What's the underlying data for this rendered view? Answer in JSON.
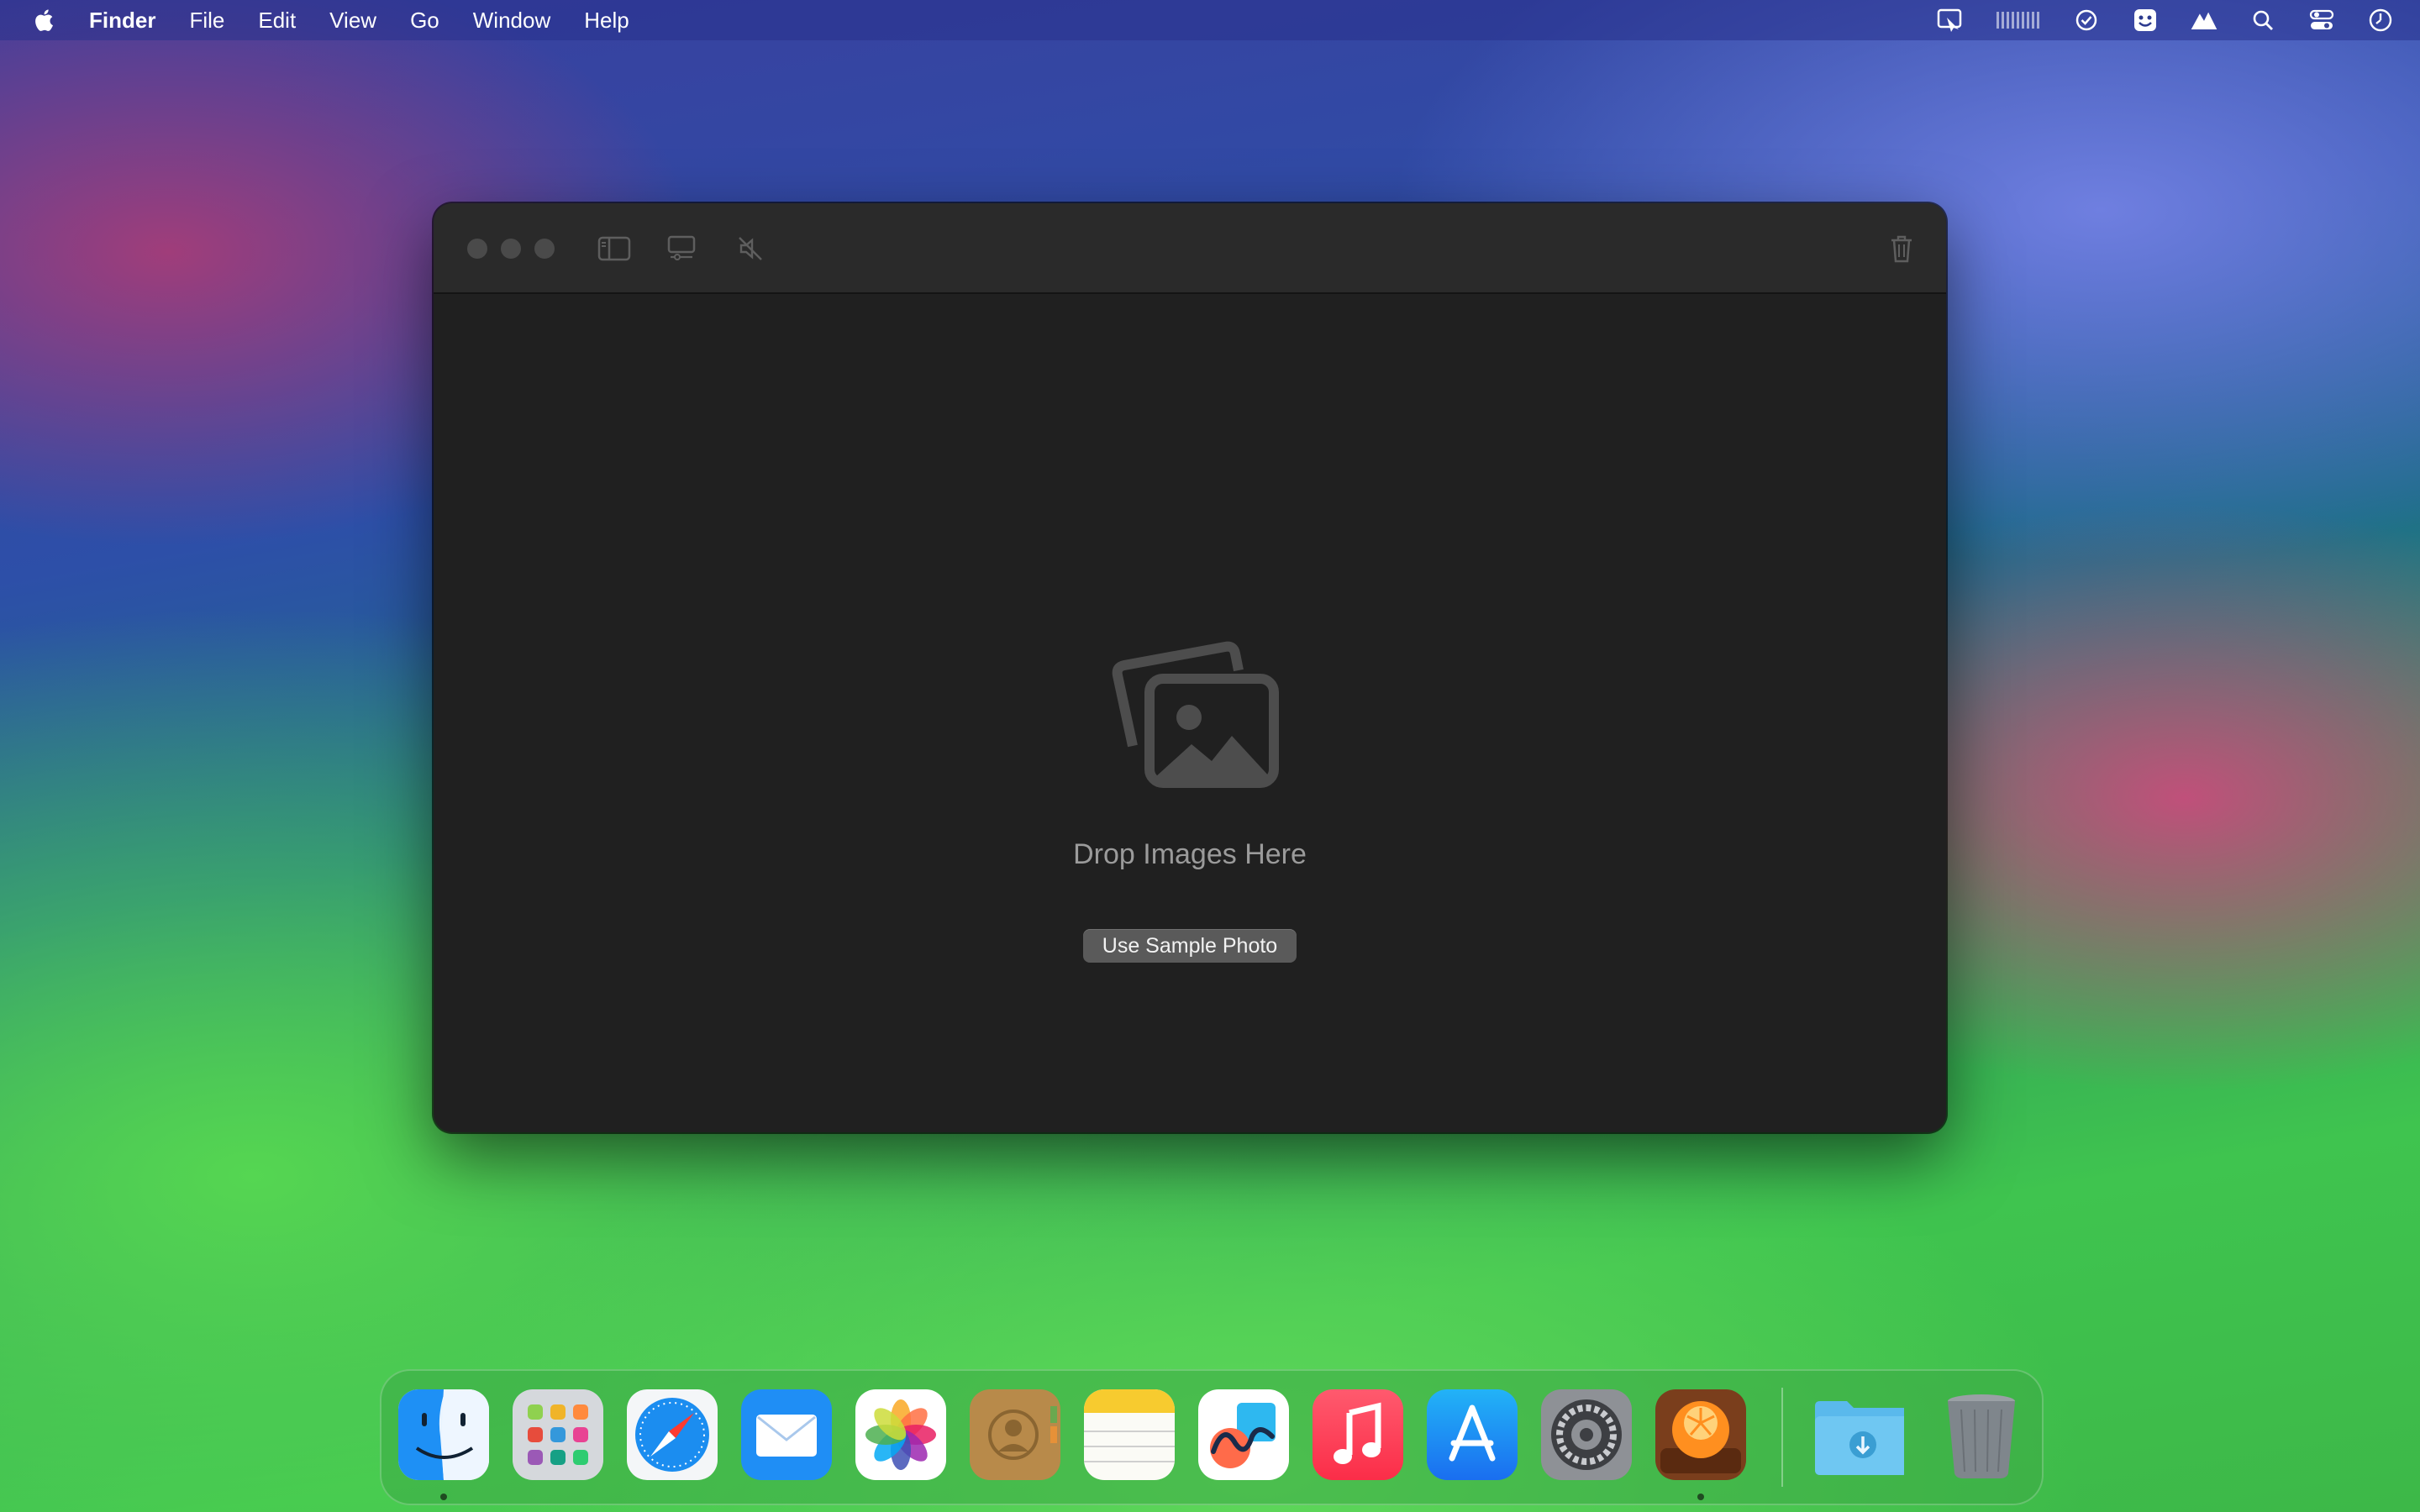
{
  "menubar": {
    "apple_icon": "apple-logo",
    "items": [
      "Finder",
      "File",
      "Edit",
      "View",
      "Go",
      "Window",
      "Help"
    ],
    "status_icons": [
      "screen-share-icon",
      "activity-grid-icon",
      "checkmark-circle-icon",
      "face-box-icon",
      "mountain-icon",
      "search-icon",
      "control-center-icon",
      "clock-icon"
    ]
  },
  "window": {
    "toolbar_icons": [
      "sidebar-toggle-icon",
      "display-settings-icon",
      "speaker-muted-icon",
      "trash-icon"
    ],
    "drop_label": "Drop Images Here",
    "sample_button": "Use Sample Photo"
  },
  "dock": {
    "apps": [
      "Finder",
      "Launchpad",
      "Safari",
      "Mail",
      "Photos",
      "Contacts",
      "Notes",
      "Freeform",
      "Music",
      "App Store",
      "System Settings",
      "Squash"
    ],
    "running": [
      "Finder",
      "Squash"
    ],
    "right": [
      "Downloads",
      "Trash"
    ]
  },
  "colors": {
    "window_bg": "#202020",
    "titlebar_bg": "#2a2a2a",
    "label_gray": "#9b9b9b",
    "button_bg": "#5a5a5a"
  }
}
